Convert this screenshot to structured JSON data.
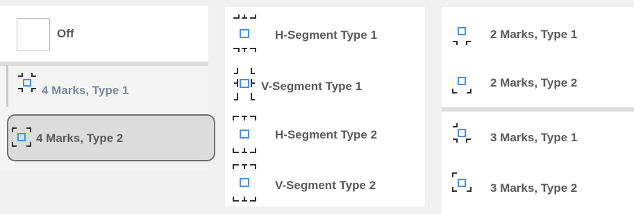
{
  "colors": {
    "label": "#5a5a5a",
    "label_muted": "#7b8896",
    "accent": "#4a8fe0",
    "mark": "#303030",
    "selected_bg": "#dcdcdc",
    "selected_border": "#707070"
  },
  "left": {
    "items": [
      {
        "label": "Off",
        "icon": "empty-square-icon"
      },
      {
        "label": "4 Marks, Type 1",
        "icon": "four-marks-type1-icon"
      },
      {
        "label": "4 Marks, Type 2",
        "icon": "four-marks-type2-icon",
        "selected": true
      }
    ]
  },
  "middle": {
    "items": [
      {
        "label": "H-Segment Type 1",
        "icon": "h-segment-type1-icon"
      },
      {
        "label": "V-Segment Type 1",
        "icon": "v-segment-type1-icon"
      },
      {
        "label": "H-Segment Type 2",
        "icon": "h-segment-type2-icon"
      },
      {
        "label": "V-Segment Type 2",
        "icon": "v-segment-type2-icon"
      }
    ]
  },
  "right": {
    "items": [
      {
        "label": "2 Marks, Type 1",
        "icon": "two-marks-type1-icon"
      },
      {
        "label": "2 Marks, Type 2",
        "icon": "two-marks-type2-icon"
      },
      {
        "label": "3 Marks, Type 1",
        "icon": "three-marks-type1-icon"
      },
      {
        "label": "3 Marks, Type 2",
        "icon": "three-marks-type2-icon"
      }
    ]
  }
}
